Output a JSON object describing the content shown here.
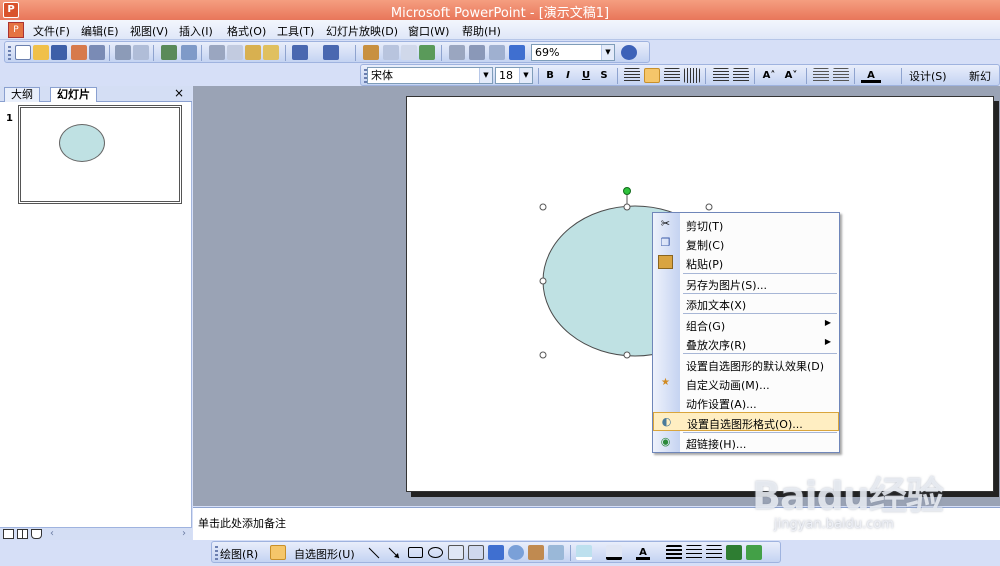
{
  "window": {
    "title": "Microsoft PowerPoint - [演示文稿1]"
  },
  "menubar": {
    "items": [
      "文件(F)",
      "编辑(E)",
      "视图(V)",
      "插入(I)",
      "格式(O)",
      "工具(T)",
      "幻灯片放映(D)",
      "窗口(W)",
      "帮助(H)"
    ]
  },
  "standard_toolbar": {
    "zoom": "69%"
  },
  "formatting_toolbar": {
    "font": "宋体",
    "size": "18",
    "bold": "B",
    "italic": "I",
    "underline": "U",
    "shadow": "S",
    "increase_font": "A˄",
    "decrease_font": "A˅",
    "design_label": "设计(S)",
    "new_slide_label": "新幻"
  },
  "left_pane": {
    "tabs": [
      "大纲",
      "幻灯片"
    ],
    "active_tab": "幻灯片",
    "close": "×",
    "slide_number": "1"
  },
  "notes": {
    "placeholder": "单击此处添加备注"
  },
  "drawing_toolbar": {
    "draw_label": "绘图(R)",
    "autoshapes_label": "自选图形(U)"
  },
  "context_menu": {
    "items": [
      {
        "label": "剪切(T)",
        "icon": "scissors-icon"
      },
      {
        "label": "复制(C)",
        "icon": "copy-icon"
      },
      {
        "label": "粘贴(P)",
        "icon": "paste-icon"
      },
      {
        "label": "另存为图片(S)...",
        "icon": ""
      },
      {
        "label": "添加文本(X)",
        "icon": ""
      },
      {
        "label": "组合(G)",
        "icon": "",
        "submenu": true
      },
      {
        "label": "叠放次序(R)",
        "icon": "",
        "submenu": true
      },
      {
        "label": "设置自选图形的默认效果(D)",
        "icon": ""
      },
      {
        "label": "自定义动画(M)...",
        "icon": "animation-icon"
      },
      {
        "label": "动作设置(A)...",
        "icon": ""
      },
      {
        "label": "设置自选图形格式(O)...",
        "icon": "format-shape-icon",
        "highlighted": true
      },
      {
        "label": "超链接(H)...",
        "icon": "hyperlink-icon"
      }
    ]
  },
  "watermark": {
    "logo": "Baidu经验",
    "url": "jingyan.baidu.com"
  },
  "colors": {
    "shape_fill": "#bfe1e3",
    "title_bar": "#e8765a",
    "highlight": "#ffeec2"
  }
}
